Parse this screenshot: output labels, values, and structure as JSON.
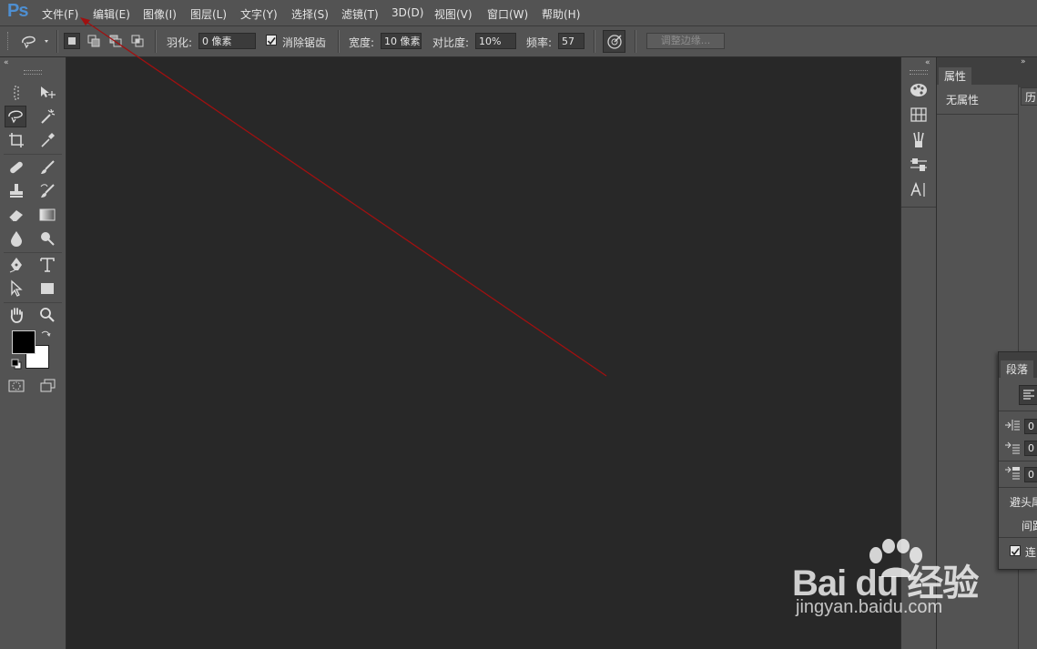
{
  "app": {
    "logo": "Ps"
  },
  "menu": {
    "items": [
      "文件(F)",
      "编辑(E)",
      "图像(I)",
      "图层(L)",
      "文字(Y)",
      "选择(S)",
      "滤镜(T)",
      "3D(D)",
      "视图(V)",
      "窗口(W)",
      "帮助(H)"
    ]
  },
  "options": {
    "feather_label": "羽化:",
    "feather_value": "0 像素",
    "antialias_label": "消除锯齿",
    "antialias_checked": true,
    "width_label": "宽度:",
    "width_value": "10 像素",
    "contrast_label": "对比度:",
    "contrast_value": "10%",
    "frequency_label": "频率:",
    "frequency_value": "57",
    "refine_label": "调整边缘..."
  },
  "panels": {
    "properties_tab": "属性",
    "properties_empty": "无属性",
    "history_tab": "历",
    "paragraph_tab": "段落",
    "paragraph_fields": [
      "0",
      "0",
      "0"
    ],
    "avoid_label": "避头尾",
    "spacing_label": "间距",
    "hyphenate_label": "连",
    "hyphenate_checked": true
  },
  "colors": {
    "accent_logo": "#4e8fd1",
    "annotation_line": "#a01010",
    "foreground": "#000000",
    "background": "#ffffff"
  },
  "watermark": {
    "logo": "Bai du 经验",
    "url": "jingyan.baidu.com"
  }
}
